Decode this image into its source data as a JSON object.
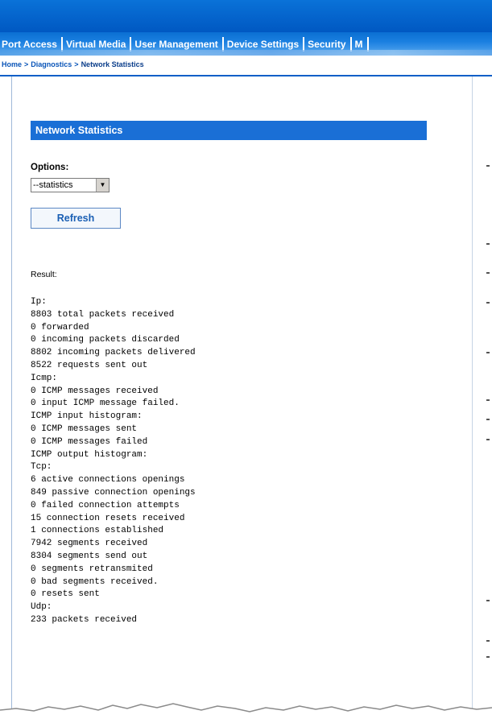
{
  "header": {
    "tabs": [
      {
        "label": "Port Access"
      },
      {
        "label": "Virtual Media"
      },
      {
        "label": "User Management"
      },
      {
        "label": "Device Settings"
      },
      {
        "label": "Security"
      },
      {
        "label": "M"
      }
    ]
  },
  "breadcrumb": {
    "home": "Home",
    "separator": ">",
    "section": "Diagnostics",
    "current": "Network Statistics"
  },
  "panel": {
    "title": "Network Statistics",
    "options_label": "Options:",
    "select_value": "--statistics",
    "refresh_label": "Refresh",
    "result_label": "Result:",
    "result_lines": [
      "Ip:",
      "8803 total packets received",
      "0 forwarded",
      "0 incoming packets discarded",
      "8802 incoming packets delivered",
      "8522 requests sent out",
      "Icmp:",
      "0 ICMP messages received",
      "0 input ICMP message failed.",
      "ICMP input histogram:",
      "0 ICMP messages sent",
      "0 ICMP messages failed",
      "ICMP output histogram:",
      "Tcp:",
      "6 active connections openings",
      "849 passive connection openings",
      "0 failed connection attempts",
      "15 connection resets received",
      "1 connections established",
      "7942 segments received",
      "8304 segments send out",
      "0 segments retransmited",
      "0 bad segments received.",
      "0 resets sent",
      "Udp:",
      "233 packets received"
    ]
  },
  "colors": {
    "header_blue": "#0a6fd2",
    "section_header": "#1a6fd6",
    "link": "#0a55b8"
  }
}
